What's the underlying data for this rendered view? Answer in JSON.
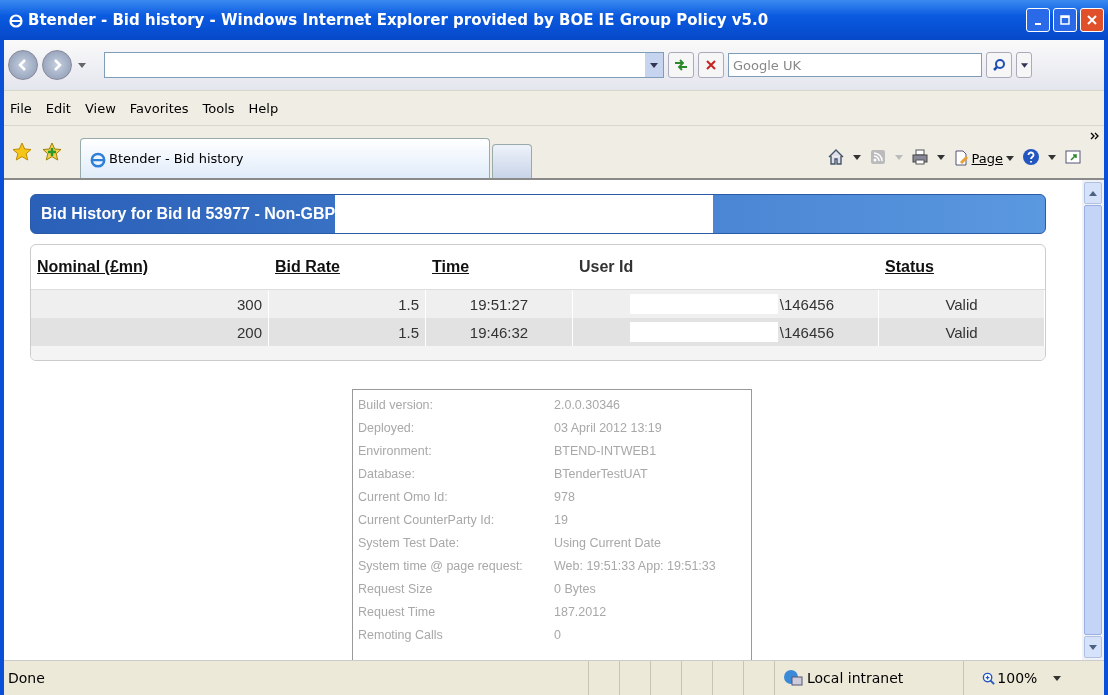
{
  "window": {
    "title": "Btender - Bid history - Windows Internet Explorer provided by BOE IE Group Policy v5.0"
  },
  "address_bar": {
    "search_placeholder": "Google UK"
  },
  "menu": [
    "File",
    "Edit",
    "View",
    "Favorites",
    "Tools",
    "Help"
  ],
  "tabs": [
    {
      "label": "Btender - Bid history",
      "selected": true
    }
  ],
  "toolbar": {
    "page_label": "Page"
  },
  "panel": {
    "title": "Bid History for Bid Id 53977 - Non-GBP"
  },
  "table": {
    "columns": [
      {
        "label": "Nominal (£mn)",
        "sortable": true
      },
      {
        "label": "Bid Rate",
        "sortable": true
      },
      {
        "label": "Time",
        "sortable": true
      },
      {
        "label": "User Id",
        "sortable": false
      },
      {
        "label": "Status",
        "sortable": true
      }
    ],
    "rows": [
      [
        "300",
        "1.5",
        "19:51:27",
        "\\146456",
        "Valid"
      ],
      [
        "200",
        "1.5",
        "19:46:32",
        "\\146456",
        "Valid"
      ]
    ]
  },
  "build_info": [
    [
      "Build version:",
      "2.0.0.30346"
    ],
    [
      "Deployed:",
      "03 April 2012 13:19"
    ],
    [
      "Environment:",
      "BTEND-INTWEB1"
    ],
    [
      "Database:",
      "BTenderTestUAT"
    ],
    [
      "Current Omo Id:",
      "978"
    ],
    [
      "Current CounterParty Id:",
      "19"
    ],
    [
      "System Test Date:",
      "Using Current Date"
    ],
    [
      "System time @ page request:",
      "Web: 19:51:33 App: 19:51:33"
    ],
    [
      "Request Size",
      "0 Bytes"
    ],
    [
      "Request Time",
      "187.2012"
    ],
    [
      "Remoting Calls",
      "0"
    ]
  ],
  "status_bar": {
    "text": "Done",
    "zone": "Local intranet",
    "zoom": "100%"
  }
}
